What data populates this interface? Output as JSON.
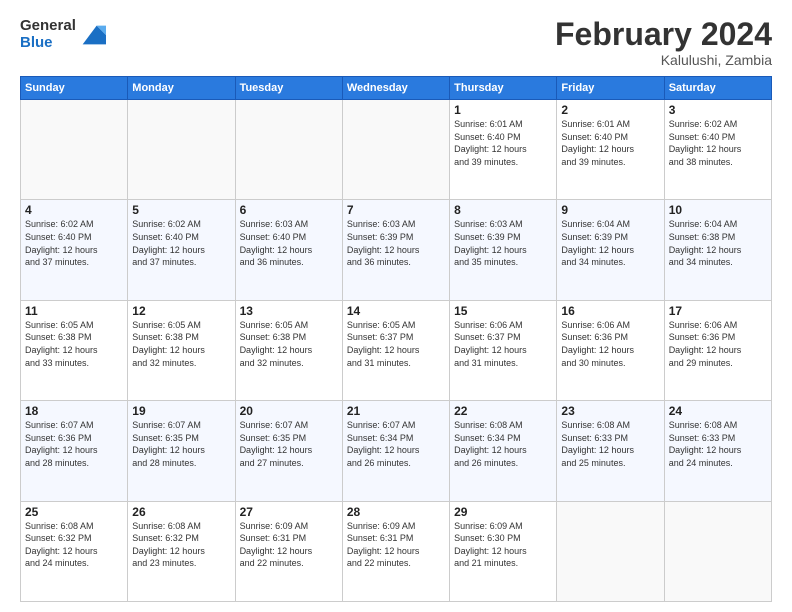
{
  "header": {
    "logo_general": "General",
    "logo_blue": "Blue",
    "title": "February 2024",
    "subtitle": "Kalulushi, Zambia"
  },
  "days_of_week": [
    "Sunday",
    "Monday",
    "Tuesday",
    "Wednesday",
    "Thursday",
    "Friday",
    "Saturday"
  ],
  "weeks": [
    [
      {
        "day": "",
        "info": ""
      },
      {
        "day": "",
        "info": ""
      },
      {
        "day": "",
        "info": ""
      },
      {
        "day": "",
        "info": ""
      },
      {
        "day": "1",
        "info": "Sunrise: 6:01 AM\nSunset: 6:40 PM\nDaylight: 12 hours\nand 39 minutes."
      },
      {
        "day": "2",
        "info": "Sunrise: 6:01 AM\nSunset: 6:40 PM\nDaylight: 12 hours\nand 39 minutes."
      },
      {
        "day": "3",
        "info": "Sunrise: 6:02 AM\nSunset: 6:40 PM\nDaylight: 12 hours\nand 38 minutes."
      }
    ],
    [
      {
        "day": "4",
        "info": "Sunrise: 6:02 AM\nSunset: 6:40 PM\nDaylight: 12 hours\nand 37 minutes."
      },
      {
        "day": "5",
        "info": "Sunrise: 6:02 AM\nSunset: 6:40 PM\nDaylight: 12 hours\nand 37 minutes."
      },
      {
        "day": "6",
        "info": "Sunrise: 6:03 AM\nSunset: 6:40 PM\nDaylight: 12 hours\nand 36 minutes."
      },
      {
        "day": "7",
        "info": "Sunrise: 6:03 AM\nSunset: 6:39 PM\nDaylight: 12 hours\nand 36 minutes."
      },
      {
        "day": "8",
        "info": "Sunrise: 6:03 AM\nSunset: 6:39 PM\nDaylight: 12 hours\nand 35 minutes."
      },
      {
        "day": "9",
        "info": "Sunrise: 6:04 AM\nSunset: 6:39 PM\nDaylight: 12 hours\nand 34 minutes."
      },
      {
        "day": "10",
        "info": "Sunrise: 6:04 AM\nSunset: 6:38 PM\nDaylight: 12 hours\nand 34 minutes."
      }
    ],
    [
      {
        "day": "11",
        "info": "Sunrise: 6:05 AM\nSunset: 6:38 PM\nDaylight: 12 hours\nand 33 minutes."
      },
      {
        "day": "12",
        "info": "Sunrise: 6:05 AM\nSunset: 6:38 PM\nDaylight: 12 hours\nand 32 minutes."
      },
      {
        "day": "13",
        "info": "Sunrise: 6:05 AM\nSunset: 6:38 PM\nDaylight: 12 hours\nand 32 minutes."
      },
      {
        "day": "14",
        "info": "Sunrise: 6:05 AM\nSunset: 6:37 PM\nDaylight: 12 hours\nand 31 minutes."
      },
      {
        "day": "15",
        "info": "Sunrise: 6:06 AM\nSunset: 6:37 PM\nDaylight: 12 hours\nand 31 minutes."
      },
      {
        "day": "16",
        "info": "Sunrise: 6:06 AM\nSunset: 6:36 PM\nDaylight: 12 hours\nand 30 minutes."
      },
      {
        "day": "17",
        "info": "Sunrise: 6:06 AM\nSunset: 6:36 PM\nDaylight: 12 hours\nand 29 minutes."
      }
    ],
    [
      {
        "day": "18",
        "info": "Sunrise: 6:07 AM\nSunset: 6:36 PM\nDaylight: 12 hours\nand 28 minutes."
      },
      {
        "day": "19",
        "info": "Sunrise: 6:07 AM\nSunset: 6:35 PM\nDaylight: 12 hours\nand 28 minutes."
      },
      {
        "day": "20",
        "info": "Sunrise: 6:07 AM\nSunset: 6:35 PM\nDaylight: 12 hours\nand 27 minutes."
      },
      {
        "day": "21",
        "info": "Sunrise: 6:07 AM\nSunset: 6:34 PM\nDaylight: 12 hours\nand 26 minutes."
      },
      {
        "day": "22",
        "info": "Sunrise: 6:08 AM\nSunset: 6:34 PM\nDaylight: 12 hours\nand 26 minutes."
      },
      {
        "day": "23",
        "info": "Sunrise: 6:08 AM\nSunset: 6:33 PM\nDaylight: 12 hours\nand 25 minutes."
      },
      {
        "day": "24",
        "info": "Sunrise: 6:08 AM\nSunset: 6:33 PM\nDaylight: 12 hours\nand 24 minutes."
      }
    ],
    [
      {
        "day": "25",
        "info": "Sunrise: 6:08 AM\nSunset: 6:32 PM\nDaylight: 12 hours\nand 24 minutes."
      },
      {
        "day": "26",
        "info": "Sunrise: 6:08 AM\nSunset: 6:32 PM\nDaylight: 12 hours\nand 23 minutes."
      },
      {
        "day": "27",
        "info": "Sunrise: 6:09 AM\nSunset: 6:31 PM\nDaylight: 12 hours\nand 22 minutes."
      },
      {
        "day": "28",
        "info": "Sunrise: 6:09 AM\nSunset: 6:31 PM\nDaylight: 12 hours\nand 22 minutes."
      },
      {
        "day": "29",
        "info": "Sunrise: 6:09 AM\nSunset: 6:30 PM\nDaylight: 12 hours\nand 21 minutes."
      },
      {
        "day": "",
        "info": ""
      },
      {
        "day": "",
        "info": ""
      }
    ]
  ]
}
